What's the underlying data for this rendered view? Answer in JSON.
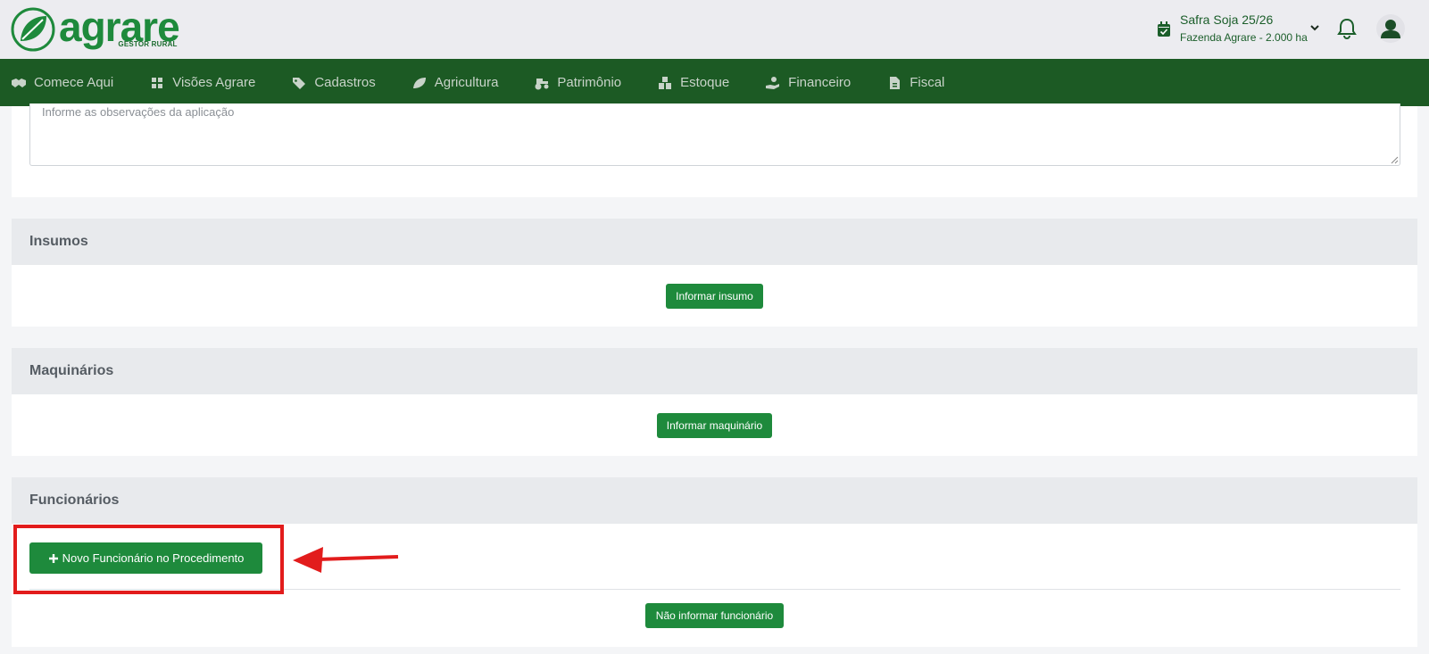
{
  "header": {
    "logo_word": "agrare",
    "logo_sub": "GESTOR RURAL",
    "safra_title": "Safra Soja 25/26",
    "safra_sub": "Fazenda Agrare - 2.000 ha",
    "icons": [
      "calendar-check-icon",
      "chevron-down-icon",
      "bell-icon",
      "user-icon"
    ]
  },
  "nav": {
    "items": [
      {
        "label": "Comece Aqui",
        "icon": "handshake-icon"
      },
      {
        "label": "Visões Agrare",
        "icon": "dashboard-icon"
      },
      {
        "label": "Cadastros",
        "icon": "tag-icon"
      },
      {
        "label": "Agricultura",
        "icon": "leaf-icon"
      },
      {
        "label": "Patrimônio",
        "icon": "tractor-icon"
      },
      {
        "label": "Estoque",
        "icon": "boxes-icon"
      },
      {
        "label": "Financeiro",
        "icon": "hand-coin-icon"
      },
      {
        "label": "Fiscal",
        "icon": "file-invoice-icon"
      }
    ]
  },
  "observacoes": {
    "placeholder": "Informe as observações da aplicação"
  },
  "insumos": {
    "title": "Insumos",
    "button": "Informar insumo"
  },
  "maquinarios": {
    "title": "Maquinários",
    "button": "Informar maquinário"
  },
  "funcionarios": {
    "title": "Funcionários",
    "add_button": "Novo Funcionário no Procedimento",
    "skip_button": "Não informar funcionário"
  },
  "annotation": {
    "highlight_color": "#e21c1c"
  },
  "colors": {
    "brand_green": "#1e8a3c",
    "nav_green": "#1c5a24"
  }
}
